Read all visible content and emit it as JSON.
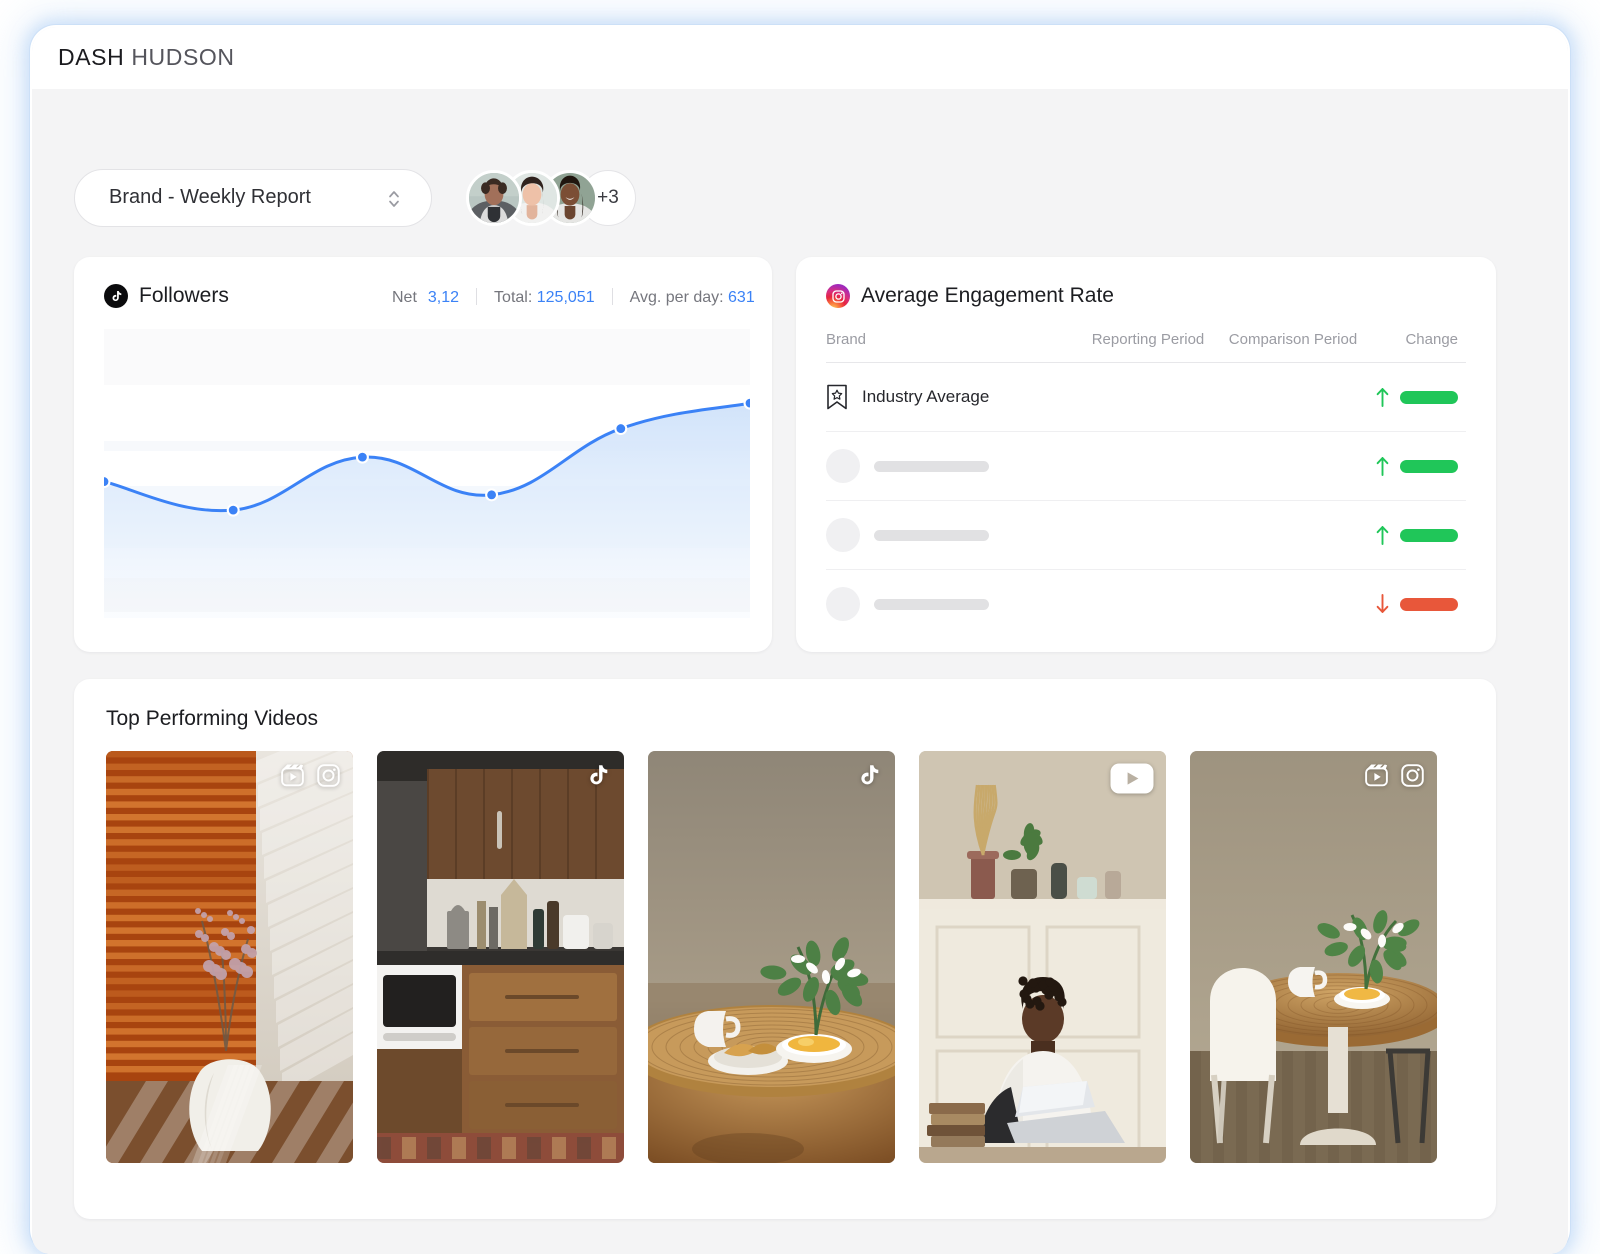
{
  "brand": {
    "logo_primary": "DASH",
    "logo_secondary": "HUDSON"
  },
  "toolbar": {
    "report_select_value": "Brand - Weekly Report",
    "avatar_overflow": "+3",
    "avatar_count": 3
  },
  "followers_card": {
    "platform_icon": "tiktok-icon",
    "title": "Followers",
    "stats": {
      "net_label": "Net",
      "net_value": "3,12",
      "total_label": "Total:",
      "total_value": "125,051",
      "avg_label": "Avg. per day:",
      "avg_value": "631"
    }
  },
  "chart_data": {
    "type": "area",
    "title": "Followers",
    "xlabel": "",
    "ylabel": "",
    "x": [
      0,
      1,
      2,
      3,
      4,
      5
    ],
    "values": [
      126,
      98,
      150,
      113,
      178,
      203
    ],
    "ylim": [
      0,
      260
    ],
    "grid": true,
    "legend": "none",
    "line_color": "#3b82f6",
    "fill_color": "#dbe9fb",
    "point_color": "#3b82f6"
  },
  "engagement_card": {
    "platform_icon": "instagram-icon",
    "title": "Average Engagement Rate",
    "columns": [
      "Brand",
      "Reporting Period",
      "Comparison Period",
      "Change"
    ],
    "rows": [
      {
        "icon": "bookmark-star-icon",
        "brand": "Industry Average",
        "reporting": "",
        "comparison": "",
        "change_direction": "up",
        "change_color": "#20c659"
      },
      {
        "icon": "avatar-placeholder",
        "brand": "",
        "reporting": "",
        "comparison": "",
        "change_direction": "up",
        "change_color": "#20c659"
      },
      {
        "icon": "avatar-placeholder",
        "brand": "",
        "reporting": "",
        "comparison": "",
        "change_direction": "up",
        "change_color": "#20c659"
      },
      {
        "icon": "avatar-placeholder",
        "brand": "",
        "reporting": "",
        "comparison": "",
        "change_direction": "down",
        "change_color": "#e8573a"
      }
    ]
  },
  "videos_card": {
    "title": "Top Performing Videos",
    "items": [
      {
        "badges": [
          "reels-icon",
          "instagram-icon"
        ],
        "scene": "window-blinds-vase"
      },
      {
        "badges": [
          "tiktok-icon"
        ],
        "scene": "wood-kitchen"
      },
      {
        "badges": [
          "tiktok-icon"
        ],
        "scene": "breakfast-table"
      },
      {
        "badges": [
          "youtube-icon"
        ],
        "scene": "person-laptop"
      },
      {
        "badges": [
          "reels-icon",
          "instagram-icon"
        ],
        "scene": "dining-table-plant"
      }
    ]
  },
  "colors": {
    "accent_blue": "#3b82f6",
    "positive_green": "#20c659",
    "negative_red": "#e8573a",
    "page_background": "#f4f4f5",
    "card_background": "#ffffff"
  }
}
